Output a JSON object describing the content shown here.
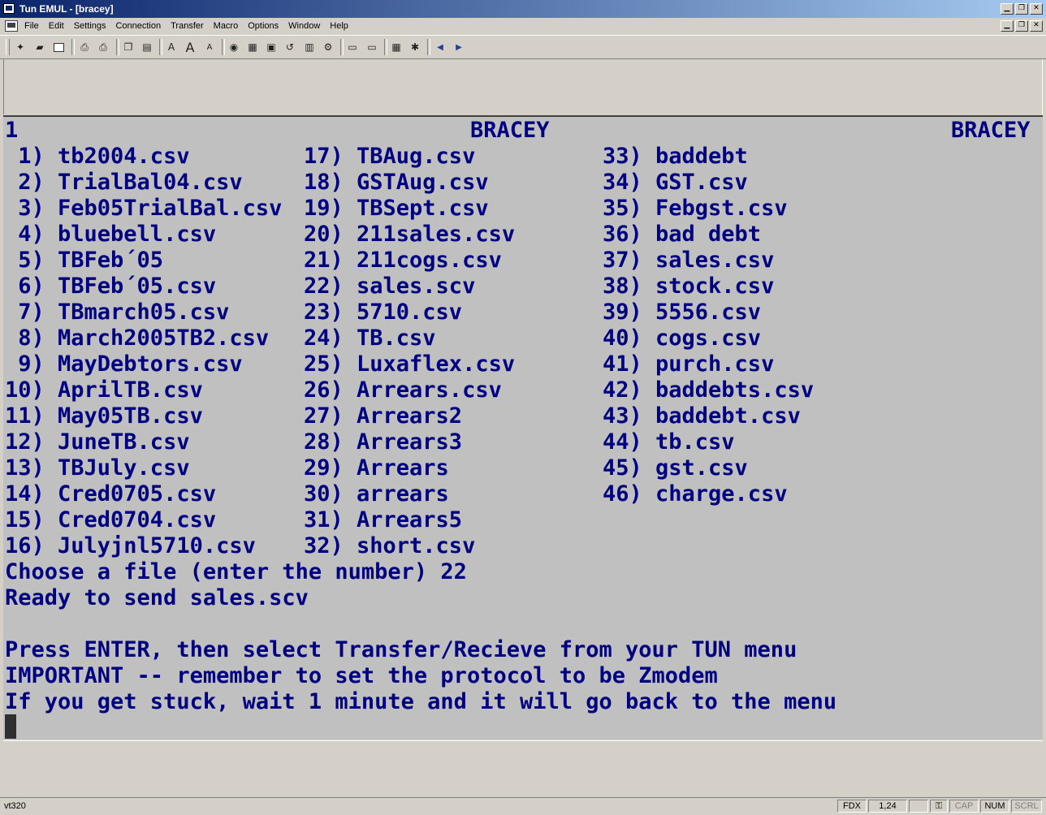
{
  "window": {
    "title": "Tun EMUL - [bracey]"
  },
  "menus": [
    "File",
    "Edit",
    "Settings",
    "Connection",
    "Transfer",
    "Macro",
    "Options",
    "Window",
    "Help"
  ],
  "terminal": {
    "header_left": "1",
    "header_center": "BRACEY",
    "header_right": "BRACEY",
    "files": [
      " 1) tb2004.csv",
      " 2) TrialBal04.csv",
      " 3) Feb05TrialBal.csv",
      " 4) bluebell.csv",
      " 5) TBFeb´05",
      " 6) TBFeb´05.csv",
      " 7) TBmarch05.csv",
      " 8) March2005TB2.csv",
      " 9) MayDebtors.csv",
      "10) AprilTB.csv",
      "11) May05TB.csv",
      "12) JuneTB.csv",
      "13) TBJuly.csv",
      "14) Cred0705.csv",
      "15) Cred0704.csv",
      "16) Julyjnl5710.csv",
      "17) TBAug.csv",
      "18) GSTAug.csv",
      "19) TBSept.csv",
      "20) 211sales.csv",
      "21) 211cogs.csv",
      "22) sales.scv",
      "23) 5710.csv",
      "24) TB.csv",
      "25) Luxaflex.csv",
      "26) Arrears.csv",
      "27) Arrears2",
      "28) Arrears3",
      "29) Arrears",
      "30) arrears",
      "31) Arrears5",
      "32) short.csv",
      "33) baddebt",
      "34) GST.csv",
      "35) Febgst.csv",
      "36) bad debt",
      "37) sales.csv",
      "38) stock.csv",
      "39) 5556.csv",
      "40) cogs.csv",
      "41) purch.csv",
      "42) baddebts.csv",
      "43) baddebt.csv",
      "44) tb.csv",
      "45) gst.csv",
      "46) charge.csv"
    ],
    "prompt": "Choose a file (enter the number) 22",
    "ready": "Ready to send sales.scv",
    "instruction1": "Press ENTER, then select Transfer/Recieve from your TUN menu",
    "instruction2": "IMPORTANT -- remember to set the protocol to be Zmodem",
    "instruction3": "If you get stuck, wait 1 minute and it will go back to the menu"
  },
  "status": {
    "emulation": "vt320",
    "duplex": "FDX",
    "position": "1,24",
    "caps": "CAP",
    "num": "NUM",
    "scroll": "SCRL"
  },
  "colors": {
    "terminal_bg": "#c0c0c0",
    "terminal_text": "#000080",
    "titlebar": "#0a246a"
  },
  "toolbar_icons": [
    "new-icon",
    "open-icon",
    "save-icon",
    "print-icon",
    "print-setup-icon",
    "copy-icon",
    "paste-icon",
    "font-size-icon",
    "font-large-icon",
    "font-small-icon",
    "connect-icon",
    "session-icon",
    "keyboard-icon",
    "macro-icon",
    "printer-icon",
    "settings-icon",
    "folder-icon",
    "folder-open-icon",
    "grid-icon",
    "tools-icon",
    "prev-arrow-icon",
    "next-arrow-icon"
  ]
}
